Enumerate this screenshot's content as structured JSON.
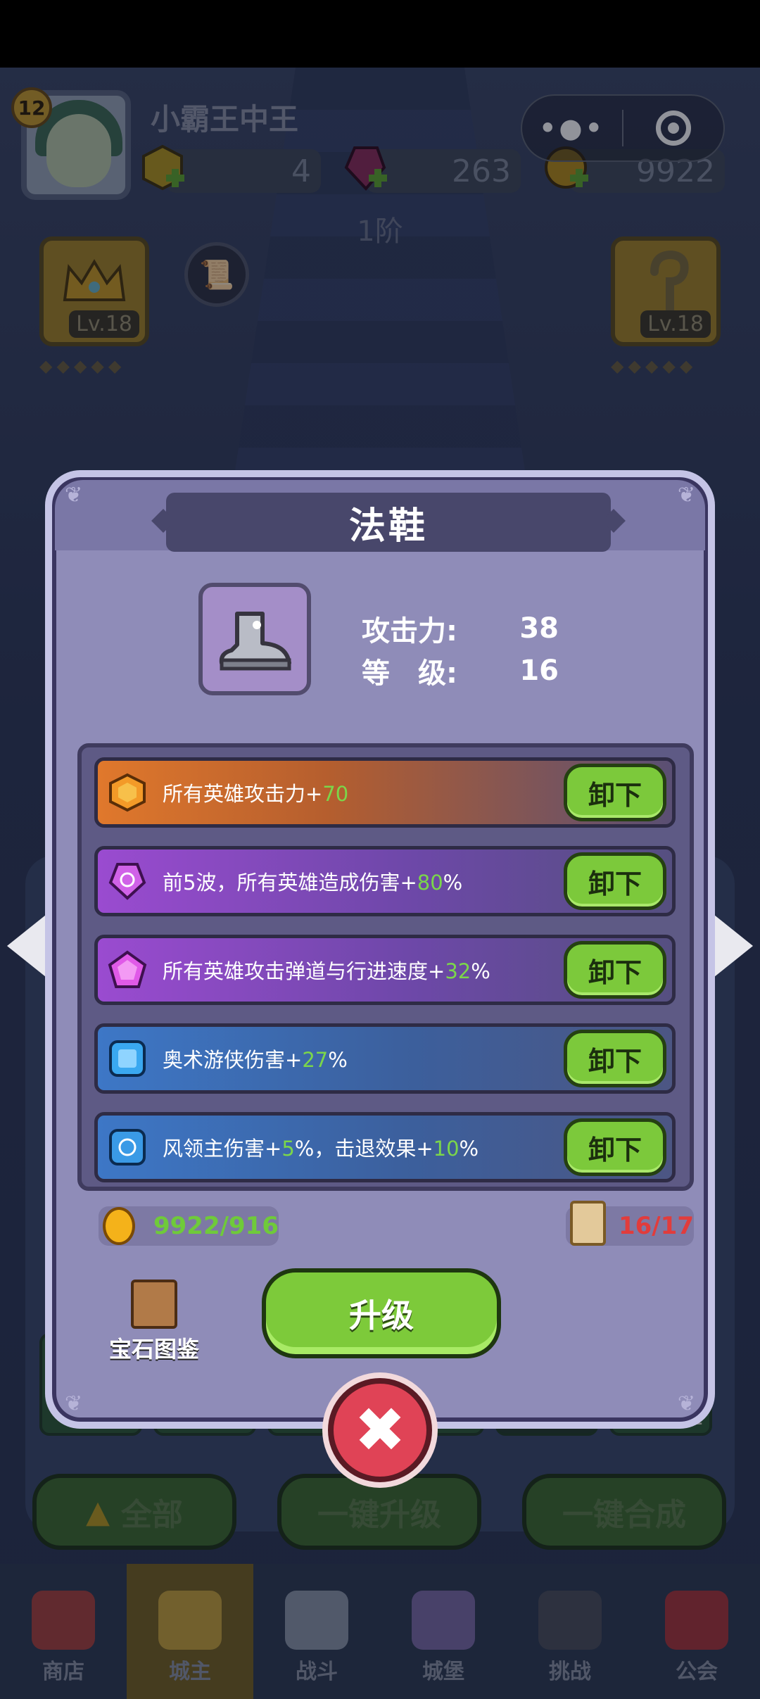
{
  "hud": {
    "level": "12",
    "player_name": "小霸王中王",
    "res_gold_gem": "4",
    "res_red_gem": "263",
    "res_coin": "9922",
    "stage": "1阶",
    "crown_lv": "Lv.18",
    "staff_lv": "Lv.18"
  },
  "modal": {
    "title": "法鞋",
    "stats": [
      {
        "label": "攻击力:",
        "value": "38"
      },
      {
        "label": "等　级:",
        "value": "16"
      }
    ],
    "gems": [
      {
        "pre": "所有英雄攻击力+",
        "num": "70",
        "post": "",
        "icon": "orange-hexagon-gem",
        "button": "卸下"
      },
      {
        "pre": "前5波，所有英雄造成伤害+",
        "num": "80",
        "post": "%",
        "icon": "purple-swirl-gem",
        "button": "卸下"
      },
      {
        "pre": "所有英雄攻击弹道与行进速度+",
        "num": "32",
        "post": "%",
        "icon": "purple-pentagon-gem",
        "button": "卸下"
      },
      {
        "pre": "奥术游侠伤害+",
        "num": "27",
        "post": "%",
        "icon": "blue-square-gem",
        "button": "卸下"
      },
      {
        "pre": "风领主伤害+",
        "num": "5",
        "post": "%，击退效果+",
        "num2": "10",
        "post2": "%",
        "icon": "blue-swirl-gem",
        "button": "卸下"
      }
    ],
    "coin_progress": "9922/916",
    "scroll_progress": "16/17",
    "book_label": "宝石图鉴",
    "upgrade_label": "升级"
  },
  "slots": [
    "1",
    "1",
    "2",
    "2",
    "1",
    "1"
  ],
  "bottom_buttons": {
    "all": "全部",
    "upgrade_all": "一键升级",
    "merge_all": "一键合成"
  },
  "nav": [
    {
      "label": "商店"
    },
    {
      "label": "城主",
      "active": true
    },
    {
      "label": "战斗"
    },
    {
      "label": "城堡"
    },
    {
      "label": "挑战"
    },
    {
      "label": "公会"
    }
  ],
  "colors": {
    "accent_green": "#7cc93b",
    "highlight_number": "#7bd64a",
    "close_red": "#e04356",
    "warning_red": "#e13c3c"
  }
}
